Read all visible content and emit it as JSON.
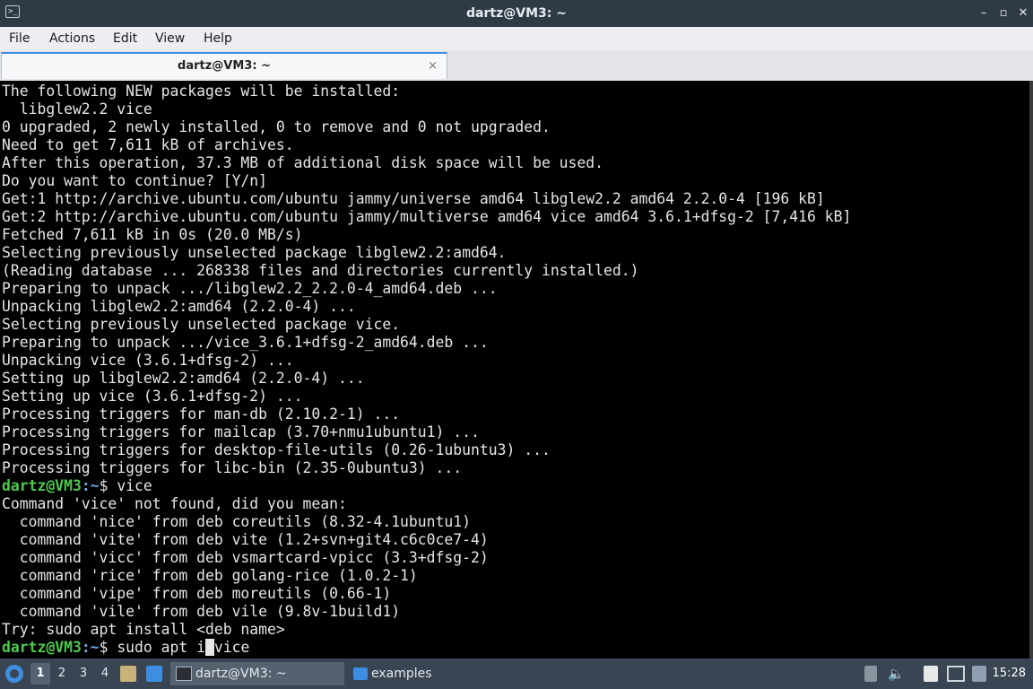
{
  "window": {
    "title": "dartz@VM3: ~",
    "controls": [
      "minimize-icon",
      "restore-icon",
      "close-icon"
    ]
  },
  "menu": [
    "File",
    "Actions",
    "Edit",
    "View",
    "Help"
  ],
  "tab": {
    "label": "dartz@VM3: ~",
    "close": "×"
  },
  "terminal": {
    "lines": [
      {
        "text": "The following NEW packages will be installed:"
      },
      {
        "text": "  libglew2.2 vice"
      },
      {
        "text": "0 upgraded, 2 newly installed, 0 to remove and 0 not upgraded."
      },
      {
        "text": "Need to get 7,611 kB of archives."
      },
      {
        "text": "After this operation, 37.3 MB of additional disk space will be used."
      },
      {
        "text": "Do you want to continue? [Y/n]"
      },
      {
        "text": "Get:1 http://archive.ubuntu.com/ubuntu jammy/universe amd64 libglew2.2 amd64 2.2.0-4 [196 kB]"
      },
      {
        "text": "Get:2 http://archive.ubuntu.com/ubuntu jammy/multiverse amd64 vice amd64 3.6.1+dfsg-2 [7,416 kB]"
      },
      {
        "text": "Fetched 7,611 kB in 0s (20.0 MB/s)"
      },
      {
        "text": "Selecting previously unselected package libglew2.2:amd64."
      },
      {
        "text": "(Reading database ... 268338 files and directories currently installed.)"
      },
      {
        "text": "Preparing to unpack .../libglew2.2_2.2.0-4_amd64.deb ..."
      },
      {
        "text": "Unpacking libglew2.2:amd64 (2.2.0-4) ..."
      },
      {
        "text": "Selecting previously unselected package vice."
      },
      {
        "text": "Preparing to unpack .../vice_3.6.1+dfsg-2_amd64.deb ..."
      },
      {
        "text": "Unpacking vice (3.6.1+dfsg-2) ..."
      },
      {
        "text": "Setting up libglew2.2:amd64 (2.2.0-4) ..."
      },
      {
        "text": "Setting up vice (3.6.1+dfsg-2) ..."
      },
      {
        "text": "Processing triggers for man-db (2.10.2-1) ..."
      },
      {
        "text": "Processing triggers for mailcap (3.70+nmu1ubuntu1) ..."
      },
      {
        "text": "Processing triggers for desktop-file-utils (0.26-1ubuntu3) ..."
      },
      {
        "text": "Processing triggers for libc-bin (2.35-0ubuntu3) ..."
      },
      {
        "prompt_user": "dartz@VM3",
        "prompt_path": ":~",
        "prompt_sym": "$ ",
        "cmd": "vice"
      },
      {
        "text": "Command 'vice' not found, did you mean:"
      },
      {
        "text": "  command 'nice' from deb coreutils (8.32-4.1ubuntu1)"
      },
      {
        "text": "  command 'vite' from deb vite (1.2+svn+git4.c6c0ce7-4)"
      },
      {
        "text": "  command 'vicc' from deb vsmartcard-vpicc (3.3+dfsg-2)"
      },
      {
        "text": "  command 'rice' from deb golang-rice (1.0.2-1)"
      },
      {
        "text": "  command 'vipe' from deb moreutils (0.66-1)"
      },
      {
        "text": "  command 'vile' from deb vile (9.8v-1build1)"
      },
      {
        "text": "Try: sudo apt install <deb name>"
      },
      {
        "prompt_user": "dartz@VM3",
        "prompt_path": ":~",
        "prompt_sym": "$ ",
        "cmd_before": "sudo apt i",
        "cursor": " ",
        "cmd_after": "vice"
      }
    ]
  },
  "taskbar": {
    "workspaces": [
      "1",
      "2",
      "3",
      "4"
    ],
    "active_workspace": "1",
    "tasks": [
      {
        "label": "dartz@VM3: ~",
        "icon": "terminal-icon",
        "active": true
      },
      {
        "label": "examples",
        "icon": "folder-icon",
        "active": false
      }
    ],
    "clock": "15:28"
  },
  "colors": {
    "terminal_bg": "#000000",
    "terminal_fg": "#e6e6e6",
    "prompt_user": "#4ec94e",
    "prompt_path": "#6aa7e8",
    "accent": "#3d8ee0"
  }
}
